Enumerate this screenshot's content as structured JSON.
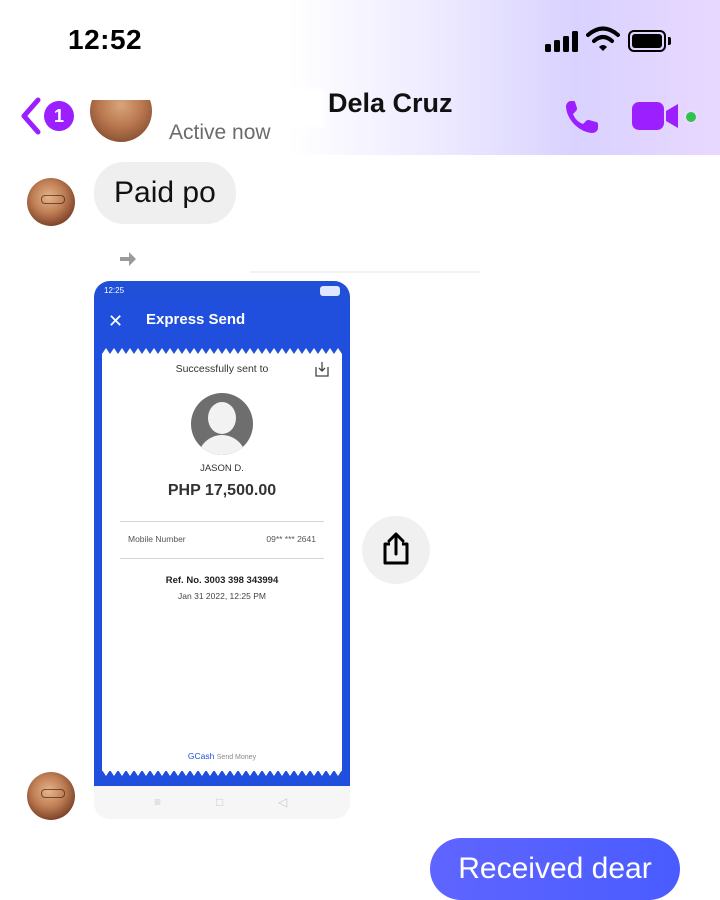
{
  "status_bar": {
    "time": "12:52"
  },
  "header": {
    "back_badge_count": "1",
    "contact_name": "Dela Cruz",
    "presence": "Active now",
    "accent_color": "#9c1fff",
    "online_color": "#31c24d"
  },
  "messages": [
    {
      "direction": "incoming",
      "text": "Paid po"
    },
    {
      "direction": "outgoing",
      "text": "Received dear"
    }
  ],
  "receipt_image": {
    "status_time": "12:25",
    "close_glyph": "✕",
    "title": "Express Send",
    "sent_to_label": "Successfully sent to",
    "recipient": "JASON D.",
    "amount": "PHP 17,500.00",
    "mobile_label": "Mobile Number",
    "mobile_value": "09** *** 2641",
    "reference": "Ref. No. 3003 398 343994",
    "datetime": "Jan 31 2022, 12:25 PM",
    "footer_brand": "GCash",
    "footer_text": "Send Money",
    "brand_color": "#1f4fdc"
  },
  "icons": {
    "back": "chevron-left-icon",
    "call": "phone-icon",
    "video": "video-camera-icon",
    "forward": "forward-arrow-icon",
    "share": "share-icon"
  },
  "outgoing_bubble_color": "#4a5cff"
}
